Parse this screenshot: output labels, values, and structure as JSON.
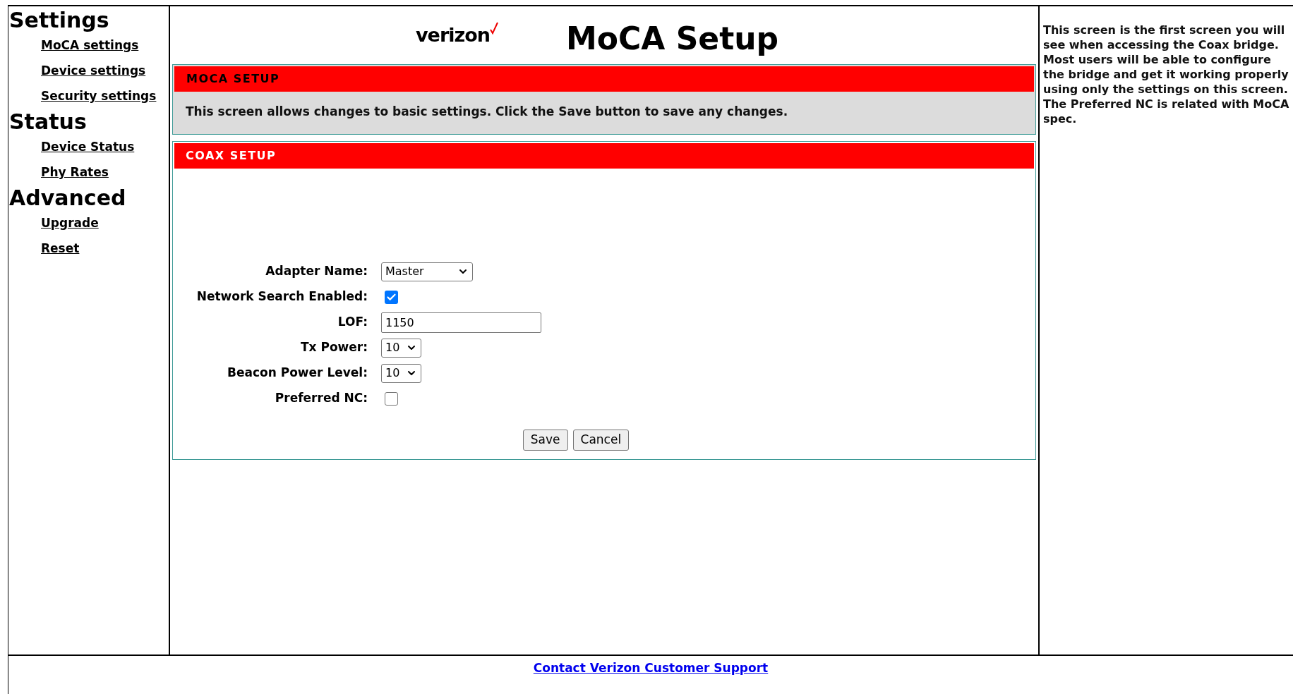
{
  "sidebar": {
    "sections": [
      {
        "heading": "Settings",
        "links": [
          "MoCA settings",
          "Device settings",
          "Security settings"
        ]
      },
      {
        "heading": "Status",
        "links": [
          "Device Status",
          "Phy Rates"
        ]
      },
      {
        "heading": "Advanced",
        "links": [
          "Upgrade",
          "Reset"
        ]
      }
    ]
  },
  "header": {
    "logo": "verizon",
    "title": "MoCA Setup"
  },
  "moca_setup": {
    "title": "MOCA SETUP",
    "description": "This screen allows changes to basic settings. Click the Save button to save any changes."
  },
  "coax_setup": {
    "title": "COAX SETUP",
    "fields": [
      {
        "kind": "select",
        "label": "Adapter Name:",
        "value": "Master"
      },
      {
        "kind": "checkbox",
        "label": "Network Search Enabled:",
        "checked": true
      },
      {
        "kind": "text",
        "label": "LOF:",
        "value": "1150"
      },
      {
        "kind": "select",
        "label": "Tx Power:",
        "value": "10"
      },
      {
        "kind": "select",
        "label": "Beacon Power Level:",
        "value": "10"
      },
      {
        "kind": "checkbox",
        "label": "Preferred NC:",
        "checked": false
      }
    ],
    "buttons": [
      "Save",
      "Cancel"
    ]
  },
  "help": {
    "text": "This screen is the first screen you will see when accessing the Coax bridge. Most users will be able to configure the bridge and get it working properly using only the settings on this screen. The Preferred NC is related with MoCA spec."
  },
  "footer": {
    "link": "Contact Verizon Customer Support"
  }
}
